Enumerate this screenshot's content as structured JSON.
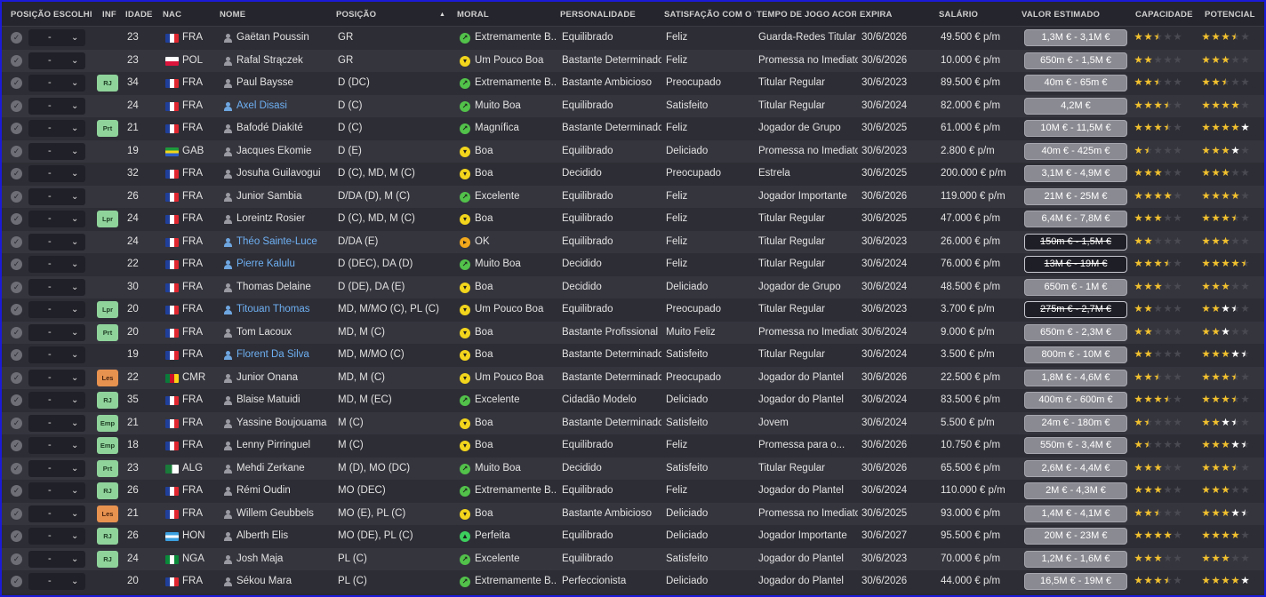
{
  "columns": {
    "pos_sel": "POSIÇÃO ESCOLHIDA",
    "inf": "INF",
    "age": "IDADE",
    "nat": "NAC",
    "name": "NOME",
    "position": "POSIÇÃO",
    "morale": "MORAL",
    "personality": "PERSONALIDADE",
    "satisfaction": "SATISFAÇÃO COM O TE...",
    "playtime": "TEMPO DE JOGO ACORDA...",
    "expires": "EXPIRA",
    "salary": "SALÁRIO",
    "value": "VALOR ESTIMADO",
    "ability": "CAPACIDADE",
    "potential": "POTENCIAL"
  },
  "sort_indicator": "▲",
  "select_placeholder": "-",
  "colors": {
    "frame_border": "#1a1ad8",
    "star": "#f2c12e",
    "badge_green": "#8fd39b",
    "badge_orange": "#e7924f",
    "name_link": "#6eb0f2"
  },
  "players": [
    {
      "inf": "",
      "inf_color": "",
      "age": "23",
      "flag": "fr",
      "nat": "FRA",
      "name": "Gaëtan Poussin",
      "blue": false,
      "pos": "GR",
      "moral_icon": "green",
      "moral": "Extremamente B...",
      "pers": "Equilibrado",
      "sat": "Feliz",
      "time": "Guarda-Redes Titular",
      "exp": "30/6/2026",
      "sal": "49.500 € p/m",
      "val": "1,3M € - 3,1M €",
      "val_out": false,
      "cap": 2.5,
      "cap_white": 0,
      "pot": 3.5,
      "pot_white": 0
    },
    {
      "inf": "",
      "inf_color": "",
      "age": "23",
      "flag": "pl",
      "nat": "POL",
      "name": "Rafal Strączek",
      "blue": false,
      "pos": "GR",
      "moral_icon": "yellow-down",
      "moral": "Um Pouco Boa",
      "pers": "Bastante Determinado",
      "sat": "Feliz",
      "time": "Promessa no Imediato",
      "exp": "30/6/2026",
      "sal": "10.000 € p/m",
      "val": "650m € - 1,5M €",
      "val_out": false,
      "cap": 2,
      "cap_white": 0,
      "pot": 3,
      "pot_white": 0
    },
    {
      "inf": "RJ",
      "inf_color": "green",
      "age": "34",
      "flag": "fr",
      "nat": "FRA",
      "name": "Paul Baysse",
      "blue": false,
      "pos": "D (DC)",
      "moral_icon": "green",
      "moral": "Extremamente B...",
      "pers": "Bastante Ambicioso",
      "sat": "Preocupado",
      "time": "Titular Regular",
      "exp": "30/6/2023",
      "sal": "89.500 € p/m",
      "val": "40m € - 65m €",
      "val_out": false,
      "cap": 2.5,
      "cap_white": 0,
      "pot": 2.5,
      "pot_white": 0
    },
    {
      "inf": "",
      "inf_color": "",
      "age": "24",
      "flag": "fr",
      "nat": "FRA",
      "name": "Axel Disasi",
      "blue": true,
      "pos": "D (C)",
      "moral_icon": "green",
      "moral": "Muito Boa",
      "pers": "Equilibrado",
      "sat": "Satisfeito",
      "time": "Titular Regular",
      "exp": "30/6/2024",
      "sal": "82.000 € p/m",
      "val": "4,2M €",
      "val_out": false,
      "cap": 3.5,
      "cap_white": 0,
      "pot": 4,
      "pot_white": 0
    },
    {
      "inf": "Prt",
      "inf_color": "green",
      "age": "21",
      "flag": "fr",
      "nat": "FRA",
      "name": "Bafodé Diakité",
      "blue": false,
      "pos": "D (C)",
      "moral_icon": "green",
      "moral": "Magnífica",
      "pers": "Bastante Determinado",
      "sat": "Feliz",
      "time": "Jogador de Grupo",
      "exp": "30/6/2025",
      "sal": "61.000 € p/m",
      "val": "10M € - 11,5M €",
      "val_out": false,
      "cap": 3.5,
      "cap_white": 0,
      "pot": 4,
      "pot_white": 1
    },
    {
      "inf": "",
      "inf_color": "",
      "age": "19",
      "flag": "ga",
      "nat": "GAB",
      "name": "Jacques Ekomie",
      "blue": false,
      "pos": "D (E)",
      "moral_icon": "yellow-down",
      "moral": "Boa",
      "pers": "Equilibrado",
      "sat": "Deliciado",
      "time": "Promessa no Imediato",
      "exp": "30/6/2023",
      "sal": "2.800 € p/m",
      "val": "40m € - 425m €",
      "val_out": false,
      "cap": 1.5,
      "cap_white": 0,
      "pot": 3,
      "pot_white": 1
    },
    {
      "inf": "",
      "inf_color": "",
      "age": "32",
      "flag": "fr",
      "nat": "FRA",
      "name": "Josuha Guilavogui",
      "blue": false,
      "pos": "D (C), MD, M (C)",
      "moral_icon": "yellow-down",
      "moral": "Boa",
      "pers": "Decidido",
      "sat": "Preocupado",
      "time": "Estrela",
      "exp": "30/6/2025",
      "sal": "200.000 € p/m",
      "val": "3,1M € - 4,9M €",
      "val_out": false,
      "cap": 3,
      "cap_white": 0,
      "pot": 3,
      "pot_white": 0
    },
    {
      "inf": "",
      "inf_color": "",
      "age": "26",
      "flag": "fr",
      "nat": "FRA",
      "name": "Junior Sambia",
      "blue": false,
      "pos": "D/DA (D), M (C)",
      "moral_icon": "green",
      "moral": "Excelente",
      "pers": "Equilibrado",
      "sat": "Feliz",
      "time": "Jogador Importante",
      "exp": "30/6/2026",
      "sal": "119.000 € p/m",
      "val": "21M € - 25M €",
      "val_out": false,
      "cap": 4,
      "cap_white": 0,
      "pot": 4,
      "pot_white": 0
    },
    {
      "inf": "Lpr",
      "inf_color": "green",
      "age": "24",
      "flag": "fr",
      "nat": "FRA",
      "name": "Loreintz Rosier",
      "blue": false,
      "pos": "D (C), MD, M (C)",
      "moral_icon": "yellow-down",
      "moral": "Boa",
      "pers": "Equilibrado",
      "sat": "Feliz",
      "time": "Titular Regular",
      "exp": "30/6/2025",
      "sal": "47.000 € p/m",
      "val": "6,4M € - 7,8M €",
      "val_out": false,
      "cap": 3,
      "cap_white": 0,
      "pot": 3.5,
      "pot_white": 0
    },
    {
      "inf": "",
      "inf_color": "",
      "age": "24",
      "flag": "fr",
      "nat": "FRA",
      "name": "Théo Sainte-Luce",
      "blue": true,
      "pos": "D/DA (E)",
      "moral_icon": "orange-right",
      "moral": "OK",
      "pers": "Equilibrado",
      "sat": "Feliz",
      "time": "Titular Regular",
      "exp": "30/6/2023",
      "sal": "26.000 € p/m",
      "val": "150m € - 1,5M €",
      "val_out": true,
      "cap": 2,
      "cap_white": 0,
      "pot": 3,
      "pot_white": 0
    },
    {
      "inf": "",
      "inf_color": "",
      "age": "22",
      "flag": "fr",
      "nat": "FRA",
      "name": "Pierre Kalulu",
      "blue": true,
      "pos": "D (DEC), DA (D)",
      "moral_icon": "green",
      "moral": "Muito Boa",
      "pers": "Decidido",
      "sat": "Feliz",
      "time": "Titular Regular",
      "exp": "30/6/2024",
      "sal": "76.000 € p/m",
      "val": "13M € - 19M €",
      "val_out": true,
      "cap": 3.5,
      "cap_white": 0,
      "pot": 4.5,
      "pot_white": 0
    },
    {
      "inf": "",
      "inf_color": "",
      "age": "30",
      "flag": "fr",
      "nat": "FRA",
      "name": "Thomas Delaine",
      "blue": false,
      "pos": "D (DE), DA (E)",
      "moral_icon": "yellow-down",
      "moral": "Boa",
      "pers": "Decidido",
      "sat": "Deliciado",
      "time": "Jogador de Grupo",
      "exp": "30/6/2024",
      "sal": "48.500 € p/m",
      "val": "650m € - 1M €",
      "val_out": false,
      "cap": 3,
      "cap_white": 0,
      "pot": 3,
      "pot_white": 0
    },
    {
      "inf": "Lpr",
      "inf_color": "green",
      "age": "20",
      "flag": "fr",
      "nat": "FRA",
      "name": "Titouan Thomas",
      "blue": true,
      "pos": "MD, M/MO (C), PL (C)",
      "moral_icon": "yellow-down",
      "moral": "Um Pouco Boa",
      "pers": "Equilibrado",
      "sat": "Preocupado",
      "time": "Titular Regular",
      "exp": "30/6/2023",
      "sal": "3.700 € p/m",
      "val": "275m € - 2,7M €",
      "val_out": true,
      "cap": 2,
      "cap_white": 0,
      "pot": 2,
      "pot_white": 1.5
    },
    {
      "inf": "Prt",
      "inf_color": "green",
      "age": "20",
      "flag": "fr",
      "nat": "FRA",
      "name": "Tom Lacoux",
      "blue": false,
      "pos": "MD, M (C)",
      "moral_icon": "yellow-down",
      "moral": "Boa",
      "pers": "Bastante Profissional",
      "sat": "Muito Feliz",
      "time": "Promessa no Imediato",
      "exp": "30/6/2024",
      "sal": "9.000 € p/m",
      "val": "650m € - 2,3M €",
      "val_out": false,
      "cap": 2,
      "cap_white": 0,
      "pot": 2,
      "pot_white": 1
    },
    {
      "inf": "",
      "inf_color": "",
      "age": "19",
      "flag": "fr",
      "nat": "FRA",
      "name": "Florent Da Silva",
      "blue": true,
      "pos": "MD, M/MO (C)",
      "moral_icon": "yellow-down",
      "moral": "Boa",
      "pers": "Bastante Determinado",
      "sat": "Satisfeito",
      "time": "Titular Regular",
      "exp": "30/6/2024",
      "sal": "3.500 € p/m",
      "val": "800m € - 10M €",
      "val_out": false,
      "cap": 2,
      "cap_white": 0,
      "pot": 3,
      "pot_white": 1.5
    },
    {
      "inf": "Les",
      "inf_color": "orange",
      "age": "22",
      "flag": "cm",
      "nat": "CMR",
      "name": "Junior Onana",
      "blue": false,
      "pos": "MD, M (C)",
      "moral_icon": "yellow-down",
      "moral": "Um Pouco Boa",
      "pers": "Bastante Determinado",
      "sat": "Preocupado",
      "time": "Jogador do Plantel",
      "exp": "30/6/2026",
      "sal": "22.500 € p/m",
      "val": "1,8M € - 4,6M €",
      "val_out": false,
      "cap": 2.5,
      "cap_white": 0,
      "pot": 3.5,
      "pot_white": 0
    },
    {
      "inf": "RJ",
      "inf_color": "green",
      "age": "35",
      "flag": "fr",
      "nat": "FRA",
      "name": "Blaise Matuidi",
      "blue": false,
      "pos": "MD, M (EC)",
      "moral_icon": "green",
      "moral": "Excelente",
      "pers": "Cidadão Modelo",
      "sat": "Deliciado",
      "time": "Jogador do Plantel",
      "exp": "30/6/2024",
      "sal": "83.500 € p/m",
      "val": "400m € - 600m €",
      "val_out": false,
      "cap": 3.5,
      "cap_white": 0,
      "pot": 3.5,
      "pot_white": 0
    },
    {
      "inf": "Emp",
      "inf_color": "green",
      "age": "21",
      "flag": "fr",
      "nat": "FRA",
      "name": "Yassine Boujouama",
      "blue": false,
      "pos": "M (C)",
      "moral_icon": "yellow-down",
      "moral": "Boa",
      "pers": "Bastante Determinado",
      "sat": "Satisfeito",
      "time": "Jovem",
      "exp": "30/6/2024",
      "sal": "5.500 € p/m",
      "val": "24m € - 180m €",
      "val_out": false,
      "cap": 1.5,
      "cap_white": 0,
      "pot": 2,
      "pot_white": 1.5
    },
    {
      "inf": "Emp",
      "inf_color": "green",
      "age": "18",
      "flag": "fr",
      "nat": "FRA",
      "name": "Lenny Pirringuel",
      "blue": false,
      "pos": "M (C)",
      "moral_icon": "yellow-down",
      "moral": "Boa",
      "pers": "Equilibrado",
      "sat": "Feliz",
      "time": "Promessa para o...",
      "exp": "30/6/2026",
      "sal": "10.750 € p/m",
      "val": "550m € - 3,4M €",
      "val_out": false,
      "cap": 1.5,
      "cap_white": 0,
      "pot": 3,
      "pot_white": 1.5
    },
    {
      "inf": "Prt",
      "inf_color": "green",
      "age": "23",
      "flag": "dz",
      "nat": "ALG",
      "name": "Mehdi Zerkane",
      "blue": false,
      "pos": "M (D), MO (DC)",
      "moral_icon": "green",
      "moral": "Muito Boa",
      "pers": "Decidido",
      "sat": "Satisfeito",
      "time": "Titular Regular",
      "exp": "30/6/2026",
      "sal": "65.500 € p/m",
      "val": "2,6M € - 4,4M €",
      "val_out": false,
      "cap": 3,
      "cap_white": 0,
      "pot": 3.5,
      "pot_white": 0
    },
    {
      "inf": "RJ",
      "inf_color": "green",
      "age": "26",
      "flag": "fr",
      "nat": "FRA",
      "name": "Rémi Oudin",
      "blue": false,
      "pos": "MO (DEC)",
      "moral_icon": "green",
      "moral": "Extremamente B...",
      "pers": "Equilibrado",
      "sat": "Feliz",
      "time": "Jogador do Plantel",
      "exp": "30/6/2024",
      "sal": "110.000 € p/m",
      "val": "2M € - 4,3M €",
      "val_out": false,
      "cap": 3,
      "cap_white": 0,
      "pot": 3,
      "pot_white": 0
    },
    {
      "inf": "Les",
      "inf_color": "orange",
      "age": "21",
      "flag": "fr",
      "nat": "FRA",
      "name": "Willem Geubbels",
      "blue": false,
      "pos": "MO (E), PL (C)",
      "moral_icon": "yellow-down",
      "moral": "Boa",
      "pers": "Bastante Ambicioso",
      "sat": "Deliciado",
      "time": "Promessa no Imediato",
      "exp": "30/6/2025",
      "sal": "93.000 € p/m",
      "val": "1,4M € - 4,1M €",
      "val_out": false,
      "cap": 2.5,
      "cap_white": 0,
      "pot": 3,
      "pot_white": 1.5
    },
    {
      "inf": "RJ",
      "inf_color": "green",
      "age": "26",
      "flag": "hn",
      "nat": "HON",
      "name": "Alberth Elis",
      "blue": false,
      "pos": "MO (DE), PL (C)",
      "moral_icon": "green-up",
      "moral": "Perfeita",
      "pers": "Equilibrado",
      "sat": "Deliciado",
      "time": "Jogador Importante",
      "exp": "30/6/2027",
      "sal": "95.500 € p/m",
      "val": "20M € - 23M €",
      "val_out": false,
      "cap": 4,
      "cap_white": 0,
      "pot": 4,
      "pot_white": 0
    },
    {
      "inf": "RJ",
      "inf_color": "green",
      "age": "24",
      "flag": "ng",
      "nat": "NGA",
      "name": "Josh Maja",
      "blue": false,
      "pos": "PL (C)",
      "moral_icon": "green",
      "moral": "Excelente",
      "pers": "Equilibrado",
      "sat": "Satisfeito",
      "time": "Jogador do Plantel",
      "exp": "30/6/2023",
      "sal": "70.000 € p/m",
      "val": "1,2M € - 1,6M €",
      "val_out": false,
      "cap": 3,
      "cap_white": 0,
      "pot": 3,
      "pot_white": 0
    },
    {
      "inf": "",
      "inf_color": "",
      "age": "20",
      "flag": "fr",
      "nat": "FRA",
      "name": "Sékou Mara",
      "blue": false,
      "pos": "PL (C)",
      "moral_icon": "green",
      "moral": "Extremamente B...",
      "pers": "Perfeccionista",
      "sat": "Deliciado",
      "time": "Jogador do Plantel",
      "exp": "30/6/2026",
      "sal": "44.000 € p/m",
      "val": "16,5M € - 19M €",
      "val_out": false,
      "cap": 3.5,
      "cap_white": 0,
      "pot": 4,
      "pot_white": 1
    }
  ]
}
